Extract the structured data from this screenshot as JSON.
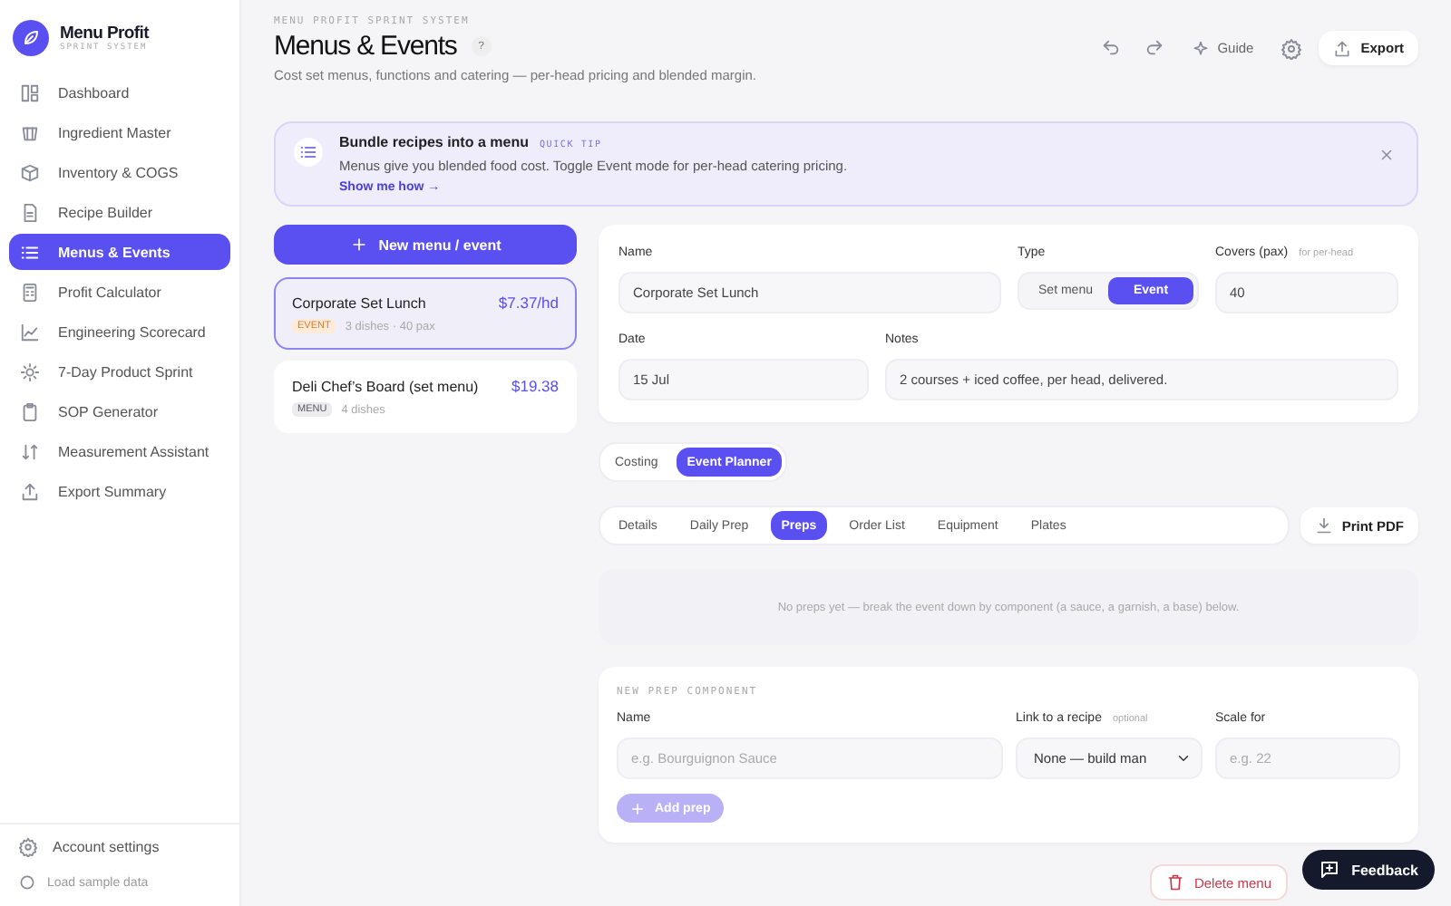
{
  "app": {
    "name": "Menu Profit",
    "tagline": "SPRINT SYSTEM"
  },
  "sidebar": {
    "items": [
      {
        "label": "Dashboard",
        "selected": false
      },
      {
        "label": "Ingredient Master",
        "selected": false
      },
      {
        "label": "Inventory & COGS",
        "selected": false
      },
      {
        "label": "Recipe Builder",
        "selected": false
      },
      {
        "label": "Menus & Events",
        "selected": true
      },
      {
        "label": "Profit Calculator",
        "selected": false
      },
      {
        "label": "Engineering Scorecard",
        "selected": false
      },
      {
        "label": "7-Day Product Sprint",
        "selected": false
      },
      {
        "label": "SOP Generator",
        "selected": false
      },
      {
        "label": "Measurement Assistant",
        "selected": false
      },
      {
        "label": "Export Summary",
        "selected": false
      }
    ],
    "footer": [
      {
        "label": "Account settings"
      },
      {
        "label": "Load sample data"
      }
    ]
  },
  "header": {
    "eyebrow": "MENU PROFIT SPRINT SYSTEM",
    "title": "Menus & Events",
    "help": "?",
    "subtitle": "Cost set menus, functions and catering — per-head pricing and blended margin.",
    "guide": "Guide",
    "export": "Export"
  },
  "tip": {
    "title": "Bundle recipes into a menu",
    "badge": "QUICK TIP",
    "text": "Menus give you blended food cost. Toggle Event mode for per-head catering pricing.",
    "link": "Show me how →"
  },
  "new_button": "New menu / event",
  "menus": [
    {
      "name": "Corporate Set Lunch",
      "price": "$7.37/hd",
      "tag": "EVENT",
      "kind": "event",
      "meta": "3 dishes · 40 pax",
      "selected": true
    },
    {
      "name": "Deli Chef’s Board (set menu)",
      "price": "$19.38",
      "tag": "MENU",
      "kind": "menu",
      "meta": "4 dishes",
      "selected": false
    }
  ],
  "form": {
    "name_label": "Name",
    "name_value": "Corporate Set Lunch",
    "type_label": "Type",
    "types": [
      {
        "label": "Set menu",
        "selected": false
      },
      {
        "label": "Event",
        "selected": true
      }
    ],
    "covers_label": "Covers (pax)",
    "covers_hint": "for per-head",
    "covers_value": "40",
    "date_label": "Date",
    "date_value": "15 Jul",
    "notes_label": "Notes",
    "notes_value": "2 courses + iced coffee, per head, delivered."
  },
  "view_tabs": [
    {
      "label": "Costing",
      "selected": false
    },
    {
      "label": "Event Planner",
      "selected": true
    }
  ],
  "planner_tabs": [
    {
      "label": "Details",
      "selected": false
    },
    {
      "label": "Daily Prep",
      "selected": false
    },
    {
      "label": "Preps",
      "selected": true
    },
    {
      "label": "Order List",
      "selected": false
    },
    {
      "label": "Equipment",
      "selected": false
    },
    {
      "label": "Plates",
      "selected": false
    }
  ],
  "print": "Print PDF",
  "empty": "No preps yet — break the event down by component (a sauce, a garnish, a base) below.",
  "new_prep": {
    "heading": "NEW PREP COMPONENT",
    "name_label": "Name",
    "name_placeholder": "e.g. Bourguignon Sauce",
    "recipe_label": "Link to a recipe",
    "recipe_hint": "optional",
    "recipe_value": "None — build man",
    "scale_label": "Scale for",
    "scale_placeholder": "e.g. 22",
    "add_button": "Add prep",
    "disabled": true
  },
  "delete": "Delete menu",
  "feedback": "Feedback"
}
